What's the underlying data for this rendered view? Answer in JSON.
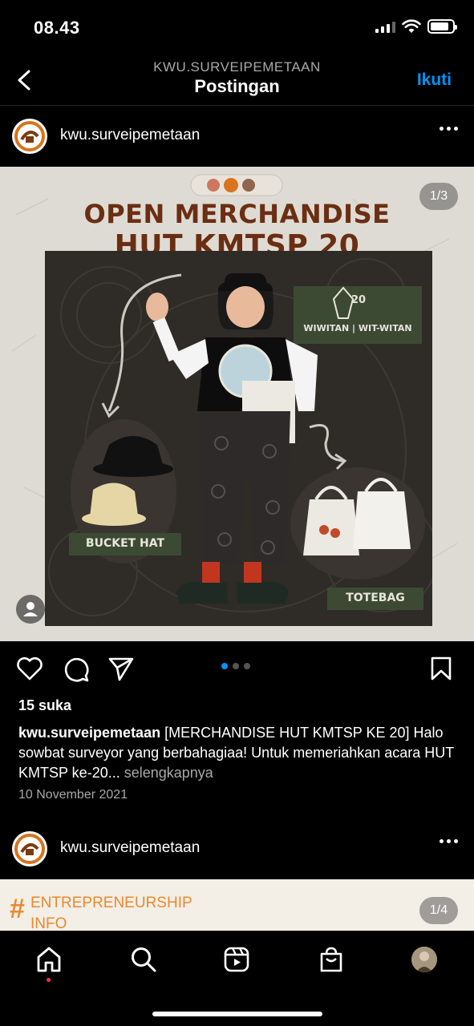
{
  "status_bar": {
    "time": "08.43",
    "battery_level": 0.85
  },
  "header": {
    "account": "KWU.SURVEIPEMETAAN",
    "title": "Postingan",
    "follow_label": "Ikuti"
  },
  "post": {
    "username": "kwu.surveipemetaan",
    "image_counter": "1/3",
    "image": {
      "title_line1": "OPEN MERCHANDISE",
      "title_line2": "HUT KMTSP 20",
      "badge_number": "20",
      "badge_label": "WIWITAN | WIT-WITAN",
      "label_hat": "BUCKET HAT",
      "label_totebag": "TOTEBAG"
    },
    "carousel": {
      "total": 3,
      "active": 1
    },
    "likes": "15 suka",
    "caption_user": "kwu.surveipemetaan",
    "caption_text": " [MERCHANDISE HUT KMTSP KE 20] Halo sowbat surveyor yang berbahagiaa! Untuk memeriahkan acara HUT KMTSP ke-20...",
    "caption_more": " selengkapnya",
    "date": "10 November 2021"
  },
  "post2": {
    "username": "kwu.surveipemetaan",
    "image_counter": "1/4",
    "image_text_line1": "ENTREPRENEURSHIP",
    "image_text_line2": "INFO",
    "hash_symbol": "#"
  },
  "colors": {
    "accent": "#0095f6",
    "background": "#000000",
    "notification": "#ff3040"
  },
  "icons": {
    "back": "chevron-left-icon",
    "like": "heart-icon",
    "comment": "comment-icon",
    "share": "send-icon",
    "save": "bookmark-icon",
    "home": "home-icon",
    "search": "search-icon",
    "reels": "reels-icon",
    "shop": "shopping-bag-icon",
    "profile": "profile-avatar"
  }
}
